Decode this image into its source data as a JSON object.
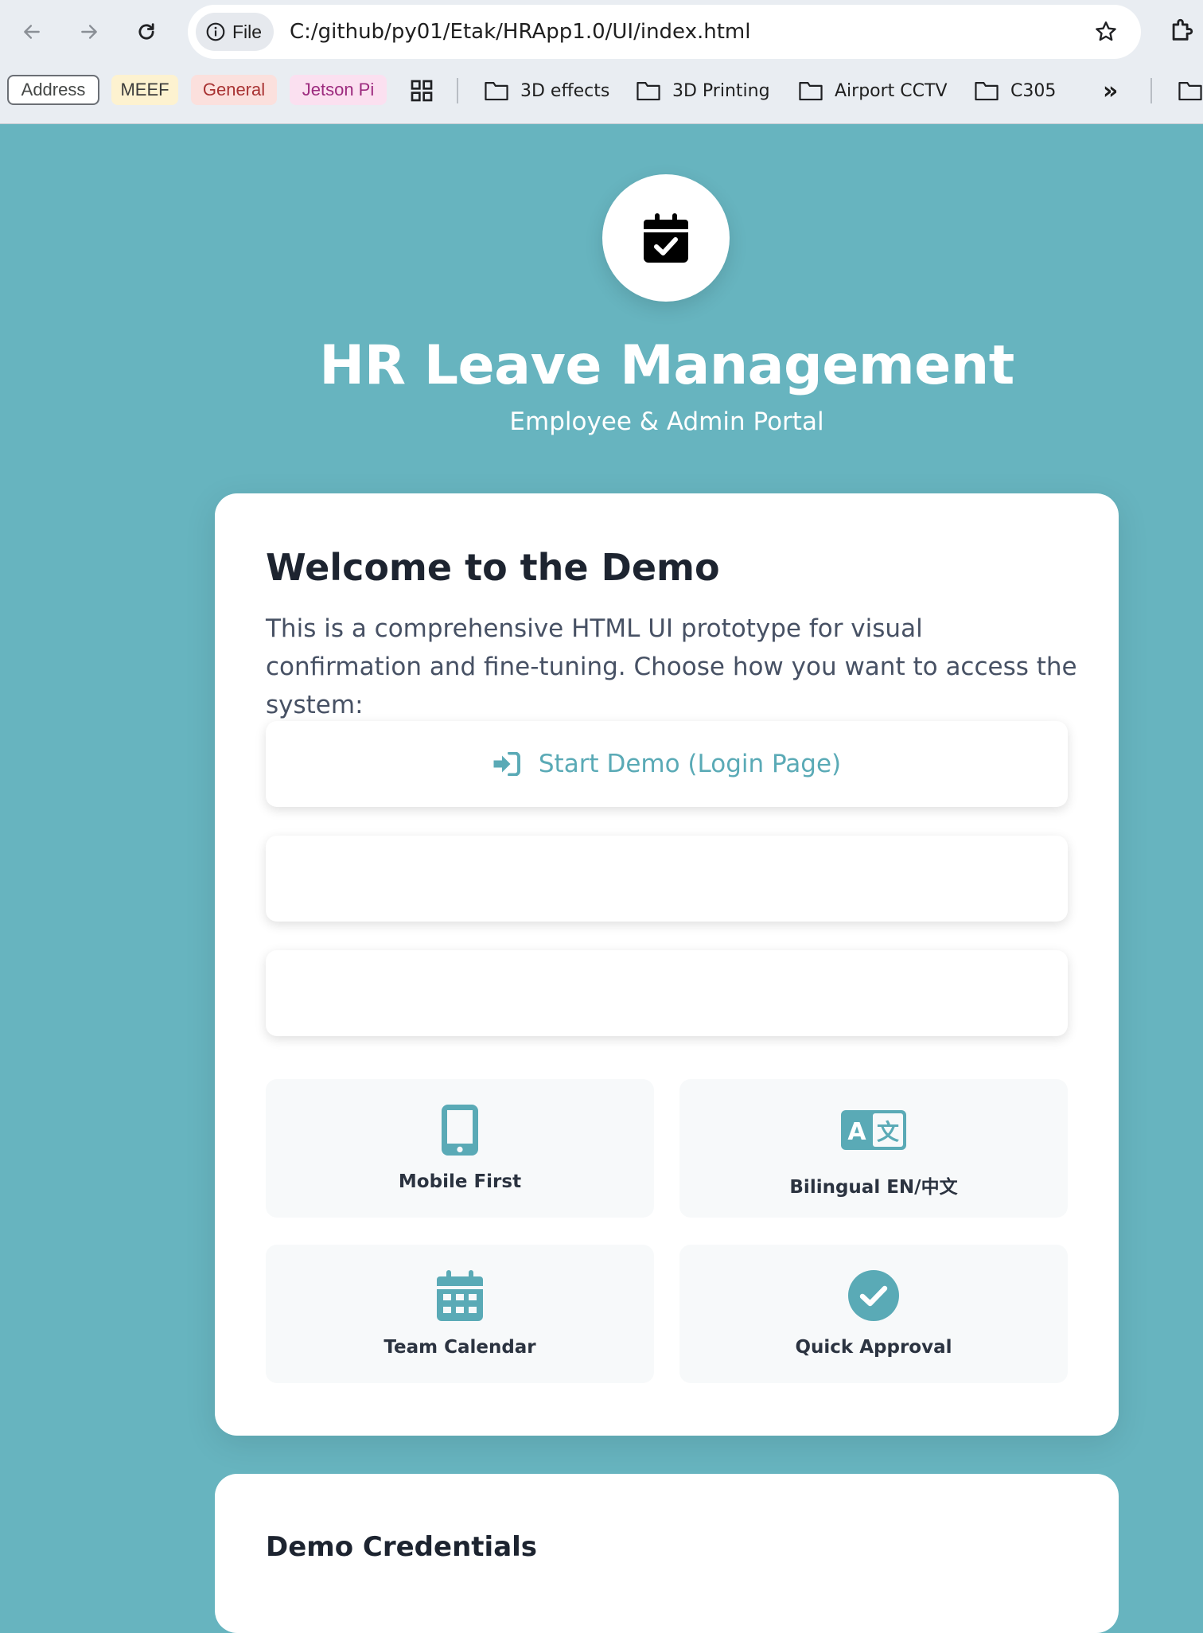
{
  "browser": {
    "site_chip": "File",
    "url": "C:/github/py01/Etak/HRApp1.0/UI/index.html",
    "bookmarks": {
      "chips": [
        {
          "label": "Address",
          "color": "#444746"
        },
        {
          "label": "MEEF",
          "color": "#3c3c3c"
        },
        {
          "label": "General",
          "color": "#a83232"
        },
        {
          "label": "Jetson Pi",
          "color": "#9c2a7e"
        }
      ],
      "folders": [
        "3D effects",
        "3D Printing",
        "Airport CCTV",
        "C305"
      ],
      "overflow": "»"
    }
  },
  "hero": {
    "icon": "calendar-check-icon",
    "title": "HR Leave Management",
    "subtitle": "Employee & Admin Portal"
  },
  "welcome": {
    "title": "Welcome to the Demo",
    "description": "This is a comprehensive HTML UI prototype for visual confirmation and fine-tuning. Choose how you want to access the system:",
    "primary_action": {
      "label": "Start Demo (Login Page)",
      "icon": "sign-in-icon"
    },
    "features": [
      {
        "label": "Mobile First",
        "icon": "mobile-icon"
      },
      {
        "label": "Bilingual EN/中文",
        "icon": "language-icon"
      },
      {
        "label": "Team Calendar",
        "icon": "calendar-icon"
      },
      {
        "label": "Quick Approval",
        "icon": "check-circle-icon"
      }
    ]
  },
  "credentials": {
    "title": "Demo Credentials"
  },
  "colors": {
    "background": "#67b4bf",
    "accent": "#5aaab6",
    "card": "#ffffff"
  }
}
